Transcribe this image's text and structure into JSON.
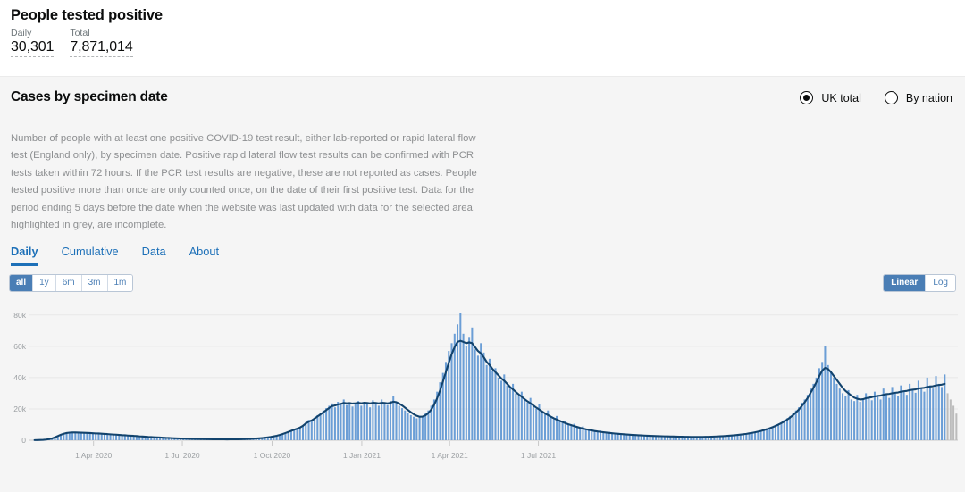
{
  "header": {
    "title": "People tested positive",
    "metrics": [
      {
        "label": "Daily",
        "value": "30,301"
      },
      {
        "label": "Total",
        "value": "7,871,014"
      }
    ]
  },
  "card": {
    "title": "Cases by specimen date",
    "description": "Number of people with at least one positive COVID-19 test result, either lab-reported or rapid lateral flow test (England only), by specimen date. Positive rapid lateral flow test results can be confirmed with PCR tests taken within 72 hours. If the PCR test results are negative, these are not reported as cases. People tested positive more than once are only counted once, on the date of their first positive test. Data for the period ending 5 days before the date when the website was last updated with data for the selected area, highlighted in grey, are incomplete.",
    "area_options": [
      {
        "label": "UK total",
        "selected": true
      },
      {
        "label": "By nation",
        "selected": false
      }
    ],
    "tabs": [
      {
        "label": "Daily",
        "active": true
      },
      {
        "label": "Cumulative",
        "active": false
      },
      {
        "label": "Data",
        "active": false
      },
      {
        "label": "About",
        "active": false
      }
    ],
    "range_buttons": [
      {
        "label": "all",
        "active": true
      },
      {
        "label": "1y",
        "active": false
      },
      {
        "label": "6m",
        "active": false
      },
      {
        "label": "3m",
        "active": false
      },
      {
        "label": "1m",
        "active": false
      }
    ],
    "scale_buttons": [
      {
        "label": "Linear",
        "active": true
      },
      {
        "label": "Log",
        "active": false
      }
    ]
  },
  "colors": {
    "bar": "#6b9ed6",
    "bar_incomplete": "#bcbcbc",
    "line": "#12436d",
    "accent": "#1d70b8",
    "toggle": "#4a7eb5",
    "card_bg": "#f5f5f5",
    "grid": "#e8e8e8"
  },
  "chart_data": {
    "type": "bar",
    "title": "Cases by specimen date",
    "xlabel": "",
    "ylabel": "",
    "ylim": [
      0,
      85000
    ],
    "ytick_values": [
      0,
      20000,
      40000,
      60000,
      80000
    ],
    "ytick_labels": [
      "0",
      "20k",
      "40k",
      "60k",
      "80k"
    ],
    "grid": true,
    "legend": "none",
    "x_start": "2020-01-30",
    "x_end": "2021-09-16",
    "bar_interval_days": 3,
    "xtick_labels": [
      "1 Apr 2020",
      "1 Jul 2020",
      "1 Oct 2020",
      "1 Jan 2021",
      "1 Apr 2021",
      "1 Jul 2021"
    ],
    "xtick_positions_days": [
      62,
      153,
      245,
      337,
      427,
      518
    ],
    "incomplete_tail_points": 4,
    "series": [
      {
        "name": "Daily cases by specimen date",
        "type": "bar",
        "values": [
          60,
          90,
          130,
          200,
          320,
          520,
          900,
          1500,
          2400,
          3300,
          4100,
          4600,
          4900,
          5100,
          5050,
          4850,
          5000,
          4700,
          4550,
          4800,
          4400,
          4250,
          4500,
          4100,
          3900,
          4050,
          3700,
          3500,
          3650,
          3300,
          3100,
          3250,
          2900,
          2750,
          2850,
          2500,
          2350,
          2450,
          2150,
          2000,
          2100,
          1850,
          1700,
          1800,
          1550,
          1400,
          1500,
          1300,
          1180,
          1250,
          1080,
          980,
          1040,
          900,
          830,
          880,
          760,
          700,
          740,
          650,
          610,
          660,
          580,
          550,
          600,
          540,
          520,
          580,
          560,
          600,
          640,
          700,
          760,
          830,
          900,
          1000,
          1100,
          1250,
          1400,
          1600,
          1850,
          2100,
          2500,
          2900,
          3400,
          4000,
          4700,
          5400,
          6100,
          6800,
          7400,
          8000,
          9500,
          11500,
          13000,
          12000,
          14500,
          16000,
          17500,
          19000,
          20500,
          22000,
          23500,
          21000,
          24500,
          23000,
          26000,
          22500,
          24000,
          21500,
          23500,
          25000,
          22000,
          24500,
          23000,
          21000,
          25500,
          23500,
          22000,
          26000,
          24000,
          22500,
          25000,
          28000,
          24500,
          22000,
          20500,
          19000,
          17500,
          16000,
          15000,
          14000,
          14500,
          15500,
          17000,
          19000,
          22000,
          26000,
          31000,
          37000,
          43000,
          50000,
          57000,
          62000,
          68000,
          74000,
          81000,
          68000,
          60000,
          66000,
          72000,
          58000,
          54000,
          62000,
          56000,
          48000,
          52000,
          44000,
          46000,
          40000,
          38000,
          42000,
          35000,
          33000,
          36000,
          30000,
          28000,
          31000,
          26000,
          24000,
          27000,
          22000,
          20000,
          23000,
          18000,
          16500,
          19000,
          15000,
          13500,
          15500,
          12000,
          11000,
          12500,
          10000,
          9200,
          10500,
          8500,
          7800,
          8800,
          7200,
          6600,
          7400,
          6000,
          5500,
          6200,
          5200,
          4800,
          5400,
          4500,
          4200,
          4700,
          4000,
          3700,
          4100,
          3500,
          3300,
          3600,
          3100,
          2900,
          3200,
          2800,
          2650,
          2900,
          2500,
          2380,
          2600,
          2300,
          2200,
          2450,
          2150,
          2050,
          2250,
          2000,
          1950,
          2150,
          1950,
          1900,
          2100,
          2000,
          2050,
          2250,
          2150,
          2200,
          2450,
          2350,
          2450,
          2700,
          2650,
          2800,
          3100,
          3050,
          3300,
          3700,
          3650,
          4000,
          4500,
          4600,
          5100,
          5800,
          6000,
          6600,
          7500,
          7900,
          8700,
          9800,
          10400,
          11500,
          13000,
          14000,
          15500,
          17500,
          19000,
          21000,
          24000,
          26000,
          29000,
          33000,
          36000,
          40000,
          46000,
          50000,
          60000,
          48000,
          44000,
          40000,
          36000,
          33000,
          30000,
          28000,
          32000,
          26000,
          25000,
          29000,
          24500,
          26500,
          30000,
          27000,
          25500,
          31000,
          28000,
          26000,
          33000,
          29000,
          27000,
          34000,
          30000,
          28500,
          35000,
          31000,
          29000,
          36000,
          32000,
          30301,
          38000,
          33000,
          31000,
          40000,
          35000,
          33000,
          41000,
          36000,
          34000,
          42000,
          30000,
          26000,
          22000,
          17000
        ]
      },
      {
        "name": "7-day rolling average",
        "type": "line",
        "values": [
          70,
          110,
          170,
          260,
          420,
          700,
          1150,
          1850,
          2700,
          3500,
          4150,
          4600,
          4850,
          4950,
          4930,
          4870,
          4830,
          4740,
          4650,
          4580,
          4450,
          4350,
          4300,
          4150,
          4020,
          3930,
          3780,
          3640,
          3560,
          3410,
          3250,
          3150,
          3000,
          2880,
          2790,
          2650,
          2500,
          2400,
          2270,
          2130,
          2040,
          1930,
          1820,
          1750,
          1630,
          1510,
          1450,
          1350,
          1260,
          1210,
          1120,
          1030,
          990,
          920,
          860,
          840,
          780,
          730,
          710,
          680,
          640,
          630,
          600,
          580,
          575,
          565,
          555,
          565,
          570,
          590,
          630,
          690,
          750,
          820,
          900,
          990,
          1100,
          1240,
          1400,
          1590,
          1820,
          2090,
          2460,
          2870,
          3350,
          3930,
          4600,
          5300,
          6000,
          6700,
          7350,
          8100,
          9200,
          10700,
          11900,
          12600,
          13800,
          15200,
          16500,
          17800,
          19200,
          20600,
          21800,
          22200,
          22900,
          23200,
          23800,
          23600,
          23700,
          23400,
          23600,
          23900,
          23600,
          23900,
          23800,
          23500,
          23900,
          23800,
          23500,
          23900,
          23800,
          23500,
          23900,
          24600,
          24300,
          23400,
          22200,
          20800,
          19300,
          17900,
          16600,
          15600,
          15000,
          15100,
          15900,
          17400,
          19600,
          22700,
          26800,
          31800,
          37500,
          43500,
          49500,
          55000,
          59500,
          62800,
          63500,
          62800,
          62000,
          62500,
          62000,
          59500,
          57000,
          55500,
          53000,
          50000,
          48000,
          45500,
          43500,
          41500,
          39500,
          38000,
          36000,
          34000,
          32500,
          30800,
          29200,
          27800,
          26200,
          24800,
          23600,
          22200,
          20800,
          19600,
          18300,
          17100,
          16100,
          15000,
          14000,
          13200,
          12400,
          11600,
          10900,
          10200,
          9600,
          9000,
          8450,
          7900,
          7450,
          7000,
          6600,
          6250,
          5900,
          5600,
          5350,
          5100,
          4870,
          4650,
          4450,
          4270,
          4100,
          3950,
          3800,
          3660,
          3530,
          3410,
          3300,
          3190,
          3090,
          3000,
          2910,
          2830,
          2760,
          2690,
          2620,
          2560,
          2500,
          2450,
          2410,
          2360,
          2310,
          2270,
          2230,
          2190,
          2160,
          2130,
          2110,
          2100,
          2100,
          2120,
          2160,
          2210,
          2270,
          2350,
          2430,
          2520,
          2630,
          2740,
          2870,
          3020,
          3180,
          3370,
          3580,
          3810,
          4070,
          4370,
          4700,
          5070,
          5480,
          5940,
          6450,
          7020,
          7650,
          8350,
          9130,
          9990,
          10950,
          12000,
          13200,
          14500,
          16000,
          17700,
          19600,
          21800,
          24200,
          27000,
          30200,
          33500,
          37000,
          41000,
          44500,
          46200,
          45500,
          43500,
          41000,
          38500,
          36000,
          33500,
          31500,
          30000,
          28500,
          27200,
          26500,
          26000,
          26200,
          26800,
          27200,
          27500,
          28000,
          28300,
          28500,
          29000,
          29400,
          29600,
          30000,
          30300,
          30500,
          31000,
          31300,
          31500,
          32000,
          32300,
          32500,
          33000,
          33300,
          33500,
          34000,
          34300,
          34500,
          35000,
          35300,
          35500,
          36000
        ]
      }
    ]
  }
}
